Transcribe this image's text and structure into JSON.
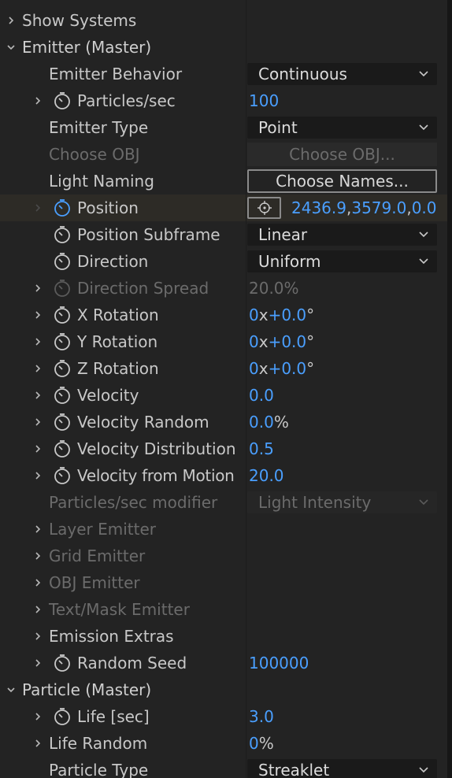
{
  "show_systems": {
    "label": "Show Systems"
  },
  "emitter": {
    "header": "Emitter (Master)",
    "emitter_behavior": {
      "label": "Emitter Behavior",
      "value": "Continuous"
    },
    "particles_sec": {
      "label": "Particles/sec",
      "value": "100"
    },
    "emitter_type": {
      "label": "Emitter Type",
      "value": "Point"
    },
    "choose_obj": {
      "label": "Choose OBJ",
      "button": "Choose OBJ..."
    },
    "light_naming": {
      "label": "Light Naming",
      "button": "Choose Names..."
    },
    "position": {
      "label": "Position",
      "x": "2436.9",
      "y": "3579.0",
      "z": "0.0",
      "sep": ","
    },
    "position_subframe": {
      "label": "Position Subframe",
      "value": "Linear"
    },
    "direction": {
      "label": "Direction",
      "value": "Uniform"
    },
    "direction_spread": {
      "label": "Direction Spread",
      "value": "20.0%"
    },
    "x_rotation": {
      "label": "X Rotation",
      "turns": "0",
      "x": "x",
      "deg": "+0.0",
      "unit": "°"
    },
    "y_rotation": {
      "label": "Y Rotation",
      "turns": "0",
      "x": "x",
      "deg": "+0.0",
      "unit": "°"
    },
    "z_rotation": {
      "label": "Z Rotation",
      "turns": "0",
      "x": "x",
      "deg": "+0.0",
      "unit": "°"
    },
    "velocity": {
      "label": "Velocity",
      "value": "0.0"
    },
    "velocity_random": {
      "label": "Velocity Random",
      "value": "0.0",
      "unit": "%"
    },
    "velocity_distribution": {
      "label": "Velocity Distribution",
      "value": "0.5"
    },
    "velocity_from_motion": {
      "label": "Velocity from Motion",
      "value": "20.0"
    },
    "particles_sec_modifier": {
      "label": "Particles/sec modifier",
      "value": "Light Intensity"
    },
    "layer_emitter": {
      "label": "Layer Emitter"
    },
    "grid_emitter": {
      "label": "Grid Emitter"
    },
    "obj_emitter": {
      "label": "OBJ Emitter"
    },
    "text_mask_emitter": {
      "label": "Text/Mask Emitter"
    },
    "emission_extras": {
      "label": "Emission Extras"
    },
    "random_seed": {
      "label": "Random Seed",
      "value": "100000"
    }
  },
  "particle": {
    "header": "Particle (Master)",
    "life": {
      "label": "Life [sec]",
      "value": "3.0"
    },
    "life_random": {
      "label": "Life Random",
      "value": "0",
      "unit": "%"
    },
    "particle_type": {
      "label": "Particle Type",
      "value": "Streaklet"
    }
  },
  "colors": {
    "value_blue": "#4a9fff",
    "background": "#232323",
    "disabled": "#6b6b6b"
  }
}
